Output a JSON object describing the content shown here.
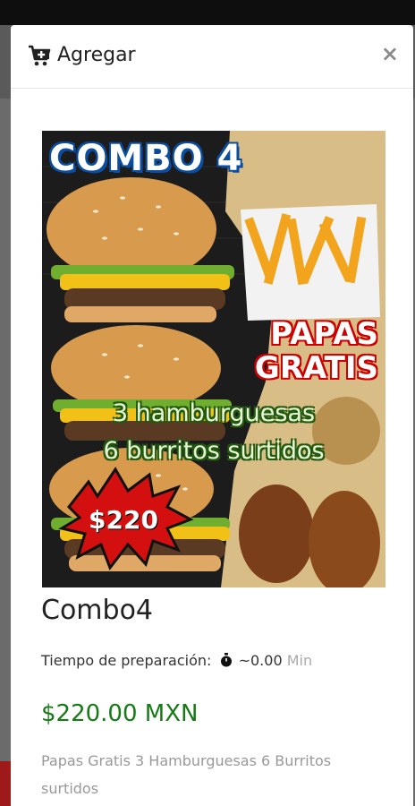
{
  "modal": {
    "title": "Agregar",
    "close_label": "×",
    "cart_icon": "cart-plus-icon",
    "close_icon": "close-icon"
  },
  "product": {
    "image_text": {
      "headline": "COMBO 4",
      "papas_line1": "PAPAS",
      "papas_line2": "GRATIS",
      "line1": "3 hamburguesas",
      "line2": "6 burritos surtidos",
      "price_burst": "$220"
    },
    "name": "Combo4",
    "prep_label": "Tiempo de preparación:",
    "prep_icon": "stopwatch-icon",
    "prep_value": "~0.00",
    "prep_unit": "Min",
    "price": "$220.00 MXN",
    "description": "Papas Gratis 3 Hamburguesas 6 Burritos surtidos"
  },
  "colors": {
    "price_green": "#177a17",
    "overlay": "#5a5a5a",
    "burst_red": "#d40f0f"
  }
}
